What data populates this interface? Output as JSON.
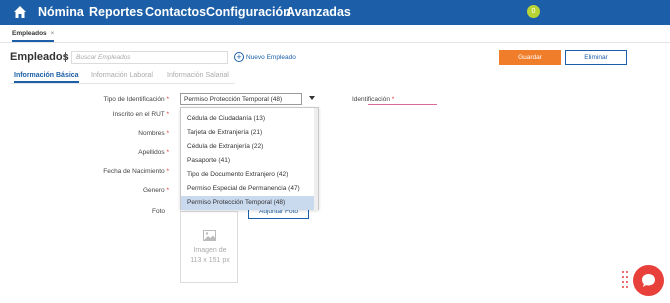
{
  "nav": {
    "items": [
      "Nómina",
      "Reportes",
      "Contactos",
      "Configuración",
      "Avanzadas"
    ],
    "user_badge": "0",
    "color": "#1c5fa8"
  },
  "tabs": {
    "open_tab": "Empleados",
    "close_glyph": "×"
  },
  "header": {
    "title": "Empleados",
    "search_placeholder": "Buscar Empleados",
    "new_employee": "Nuevo Empleado",
    "save": "Guardar",
    "delete": "Eliminar"
  },
  "subtabs": [
    "Información Básica",
    "Información Laboral",
    "Información Salarial"
  ],
  "form": {
    "tipo_id_label": "Tipo de Identificación",
    "tipo_id_value": "Permiso Protección Temporal (48)",
    "identificacion_label": "Identificación",
    "rut_label": "Inscrito en el RUT",
    "nombres_label": "Nombres",
    "apellidos_label": "Apellidos",
    "fecha_label": "Fecha de Nacimiento",
    "genero_label": "Genero",
    "foto_label": "Foto",
    "required_mark": "*"
  },
  "dropdown_options": [
    "Cédula de Ciudadanía (13)",
    "Tarjeta de Extranjería (21)",
    "Cédula de Extranjería (22)",
    "Pasaporte (41)",
    "Tipo de Documento Extranjero (42)",
    "Permiso Especial de Permanencia (47)",
    "Permiso Protección Temporal (48)"
  ],
  "dropdown_selected_index": 6,
  "photo": {
    "attach_button": "Adjuntar Foto",
    "placeholder_line1": "Imagen de",
    "placeholder_line2": "113 x 151 px"
  },
  "colors": {
    "accent": "#1c5fa8",
    "save": "#f07d2a",
    "chat": "#e8403a"
  }
}
